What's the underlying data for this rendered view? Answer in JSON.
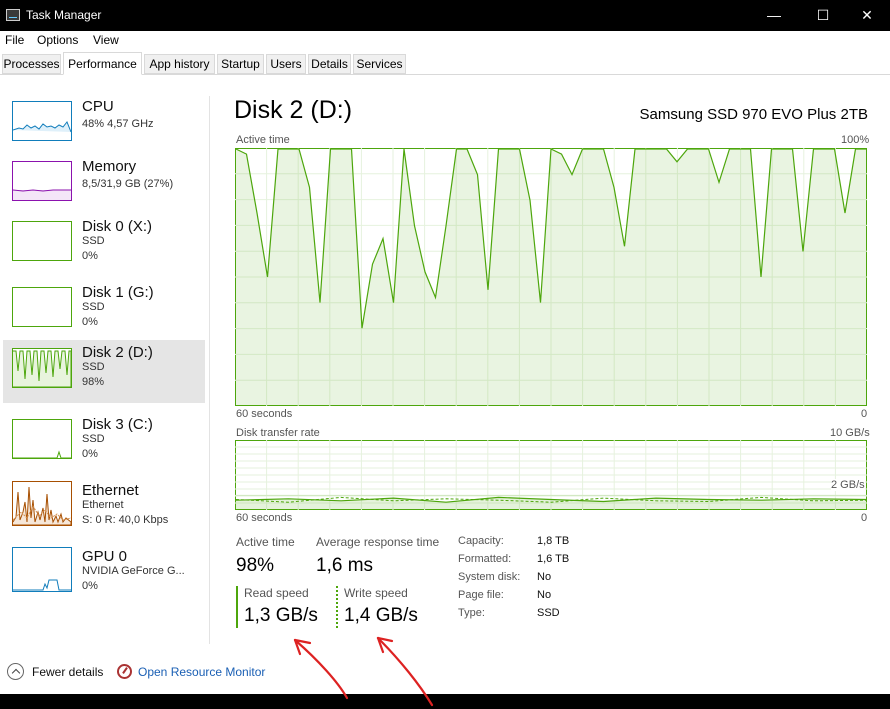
{
  "window": {
    "title": "Task Manager",
    "minimize": "—",
    "maximize": "☐",
    "close": "✕"
  },
  "menu": [
    "File",
    "Options",
    "View"
  ],
  "tabs": [
    "Processes",
    "Performance",
    "App history",
    "Startup",
    "Users",
    "Details",
    "Services"
  ],
  "sidebar": [
    {
      "name": "CPU",
      "sub1": "48% 4,57 GHz",
      "sub2": "",
      "sub3": "",
      "color": "#117dbb"
    },
    {
      "name": "Memory",
      "sub1": "8,5/31,9 GB (27%)",
      "sub2": "",
      "sub3": "",
      "color": "#8b12ae"
    },
    {
      "name": "Disk 0 (X:)",
      "sub1": "SSD",
      "sub2": "0%",
      "sub3": "",
      "color": "#4da60c"
    },
    {
      "name": "Disk 1 (G:)",
      "sub1": "SSD",
      "sub2": "0%",
      "sub3": "",
      "color": "#4da60c"
    },
    {
      "name": "Disk 2 (D:)",
      "sub1": "SSD",
      "sub2": "98%",
      "sub3": "",
      "color": "#4da60c"
    },
    {
      "name": "Disk 3 (C:)",
      "sub1": "SSD",
      "sub2": "0%",
      "sub3": "",
      "color": "#4da60c"
    },
    {
      "name": "Ethernet",
      "sub1": "Ethernet",
      "sub2": "S: 0 R: 40,0 Kbps",
      "sub3": "",
      "color": "#a74f01"
    },
    {
      "name": "GPU 0",
      "sub1": "NVIDIA GeForce G...",
      "sub2": "0%",
      "sub3": "",
      "color": "#117dbb"
    }
  ],
  "main": {
    "title": "Disk 2 (D:)",
    "model": "Samsung SSD 970 EVO Plus 2TB",
    "active_time_label": "Active time",
    "active_time_max": "100%",
    "time_span": "60 seconds",
    "zero": "0",
    "transfer_label": "Disk transfer rate",
    "transfer_max": "10 GB/s",
    "transfer_mid": "2 GB/s",
    "accent_color": "#4da60c"
  },
  "stats": {
    "active_time_label": "Active time",
    "active_time_value": "98%",
    "avg_response_label": "Average response time",
    "avg_response_value": "1,6 ms",
    "read_label": "Read speed",
    "read_value": "1,3 GB/s",
    "write_label": "Write speed",
    "write_value": "1,4 GB/s"
  },
  "properties": {
    "capacity_label": "Capacity:",
    "capacity_value": "1,8 TB",
    "formatted_label": "Formatted:",
    "formatted_value": "1,6 TB",
    "system_disk_label": "System disk:",
    "system_disk_value": "No",
    "page_file_label": "Page file:",
    "page_file_value": "No",
    "type_label": "Type:",
    "type_value": "SSD"
  },
  "footer": {
    "fewer_details": "Fewer details",
    "resource_monitor": "Open Resource Monitor"
  },
  "chart_data": [
    {
      "type": "area",
      "title": "Active time",
      "ylim": [
        0,
        100
      ],
      "x": [
        60,
        59,
        58,
        57,
        56,
        55,
        54,
        53,
        52,
        51,
        50,
        49,
        48,
        47,
        46,
        45,
        44,
        43,
        42,
        41,
        40,
        39,
        38,
        37,
        36,
        35,
        34,
        33,
        32,
        31,
        30,
        29,
        28,
        27,
        26,
        25,
        24,
        23,
        22,
        21,
        20,
        19,
        18,
        17,
        16,
        15,
        14,
        13,
        12,
        11,
        10,
        9,
        8,
        7,
        6,
        5,
        4,
        3,
        2,
        1,
        0
      ],
      "values": [
        100,
        98,
        75,
        50,
        100,
        100,
        100,
        85,
        40,
        100,
        100,
        100,
        30,
        55,
        65,
        40,
        100,
        70,
        52,
        42,
        70,
        100,
        100,
        90,
        45,
        100,
        100,
        100,
        80,
        40,
        100,
        98,
        90,
        100,
        100,
        100,
        85,
        62,
        100,
        100,
        100,
        100,
        95,
        100,
        100,
        100,
        87,
        100,
        100,
        100,
        50,
        100,
        100,
        100,
        60,
        100,
        100,
        100,
        75,
        100,
        100
      ]
    },
    {
      "type": "line",
      "title": "Disk transfer rate",
      "ylim": [
        0,
        10
      ],
      "series": [
        {
          "x": [
            60,
            55,
            50,
            45,
            40,
            35,
            30,
            25,
            20,
            15,
            10,
            5,
            0
          ],
          "values": [
            1.3,
            1.5,
            1.2,
            1.6,
            1.0,
            1.7,
            1.4,
            1.1,
            1.6,
            1.4,
            1.3,
            1.5,
            1.4
          ]
        },
        {
          "x": [
            60,
            55,
            50,
            45,
            40,
            35,
            30,
            25,
            20,
            15,
            10,
            5,
            0
          ],
          "values": [
            1.4,
            1.0,
            1.7,
            1.2,
            1.5,
            1.3,
            1.0,
            1.6,
            1.2,
            1.1,
            1.7,
            1.2,
            1.3
          ]
        }
      ]
    }
  ]
}
